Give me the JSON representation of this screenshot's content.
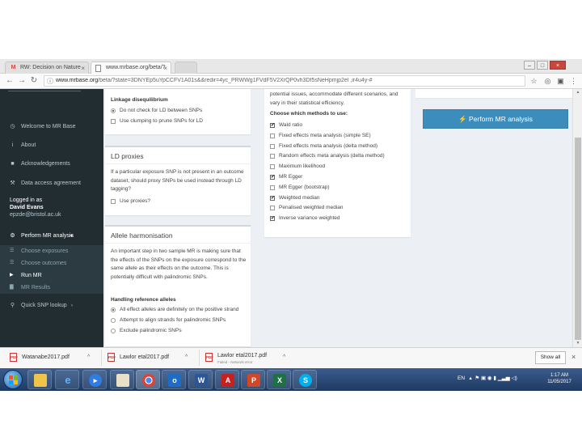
{
  "browser": {
    "tabs": [
      {
        "label": "RW: Decision on Nature",
        "icon": "gmail-icon"
      },
      {
        "label": "www.mrbase.org/beta/?",
        "icon": "page-icon"
      },
      {
        "label": "",
        "icon": "new-tab"
      }
    ],
    "url_host": "www.mrbase.org",
    "url_path": "/beta/?state=3DNYEp5uYpCCFV1A01s&&redir=4yc_PRWWg1FVdF5V2XrQP0vh3Df5sNeHpmjp2el ,ir4u4y-#"
  },
  "sidebar": {
    "items": [
      {
        "label": "Welcome to MR Base",
        "icon": "clock-icon"
      },
      {
        "label": "About",
        "icon": "info-icon"
      },
      {
        "label": "Acknowledgements",
        "icon": "bookmark-icon"
      },
      {
        "label": "Data access agreement",
        "icon": "gavel-icon"
      }
    ],
    "logged_in_label": "Logged in as",
    "user_name": "David Evans",
    "user_email": "epzde@bristol.ac.uk",
    "perform_label": "Perform MR analysis",
    "sub_items": [
      {
        "label": "Choose exposures",
        "icon": "list-icon",
        "active": false
      },
      {
        "label": "Choose outcomes",
        "icon": "list-icon",
        "active": false
      },
      {
        "label": "Run MR",
        "icon": "play-icon",
        "active": true
      },
      {
        "label": "MR Results",
        "icon": "bar-chart-icon",
        "active": false
      }
    ],
    "quick_lookup_label": "Quick SNP lookup"
  },
  "linkage": {
    "label": "Linkage disequilibrium",
    "options": [
      "Do not check for LD between SNPs",
      "Use clumping to prune SNPs for LD"
    ],
    "selected": 0
  },
  "ld_proxies": {
    "title": "LD proxies",
    "text": "If a particular exposure SNP is not present in an outcome dataset, should proxy SNPs be used instead through LD tagging?",
    "checkbox_label": "Use proxies?"
  },
  "allele": {
    "title": "Allele harmonisation",
    "text": "An important step in two sample MR is making sure that the effects of the SNPs on the exposure correspond to the same allele as their effects on the outcome. This is potentially difficult with palindromic SNPs.",
    "handling_label": "Handling reference alleles",
    "options": [
      "All effect alleles are definitely on the positive strand",
      "Attempt to align strands for palindromic SNPs",
      "Exclude palindromic SNPs"
    ],
    "selected": 0
  },
  "methods": {
    "intro": "potential issues, accommodate different scenarios, and vary in their statistical efficiency.",
    "label": "Choose which methods to use:",
    "items": [
      {
        "label": "Wald ratio",
        "checked": true
      },
      {
        "label": "Fixed effects meta analysis (simple SE)",
        "checked": false
      },
      {
        "label": "Fixed effects meta analysis (delta method)",
        "checked": false
      },
      {
        "label": "Random effects meta analysis (delta method)",
        "checked": false
      },
      {
        "label": "Maximum likelihood",
        "checked": false
      },
      {
        "label": "MR Egger",
        "checked": true
      },
      {
        "label": "MR Egger (bootstrap)",
        "checked": false
      },
      {
        "label": "Weighted median",
        "checked": true
      },
      {
        "label": "Penalised weighted median",
        "checked": false
      },
      {
        "label": "Inverse variance weighted",
        "checked": true
      }
    ]
  },
  "perform_button": "Perform MR analysis",
  "downloads": {
    "files": [
      {
        "name": "Watanabe2017.pdf",
        "sub": ""
      },
      {
        "name": "Lawlor etal2017.pdf",
        "sub": ""
      },
      {
        "name": "Lawlor etal2017.pdf",
        "sub": "Failed - Network error"
      }
    ],
    "show_all": "Show all"
  },
  "taskbar": {
    "language": "EN",
    "time": "1:17 AM",
    "date": "11/05/2017"
  }
}
